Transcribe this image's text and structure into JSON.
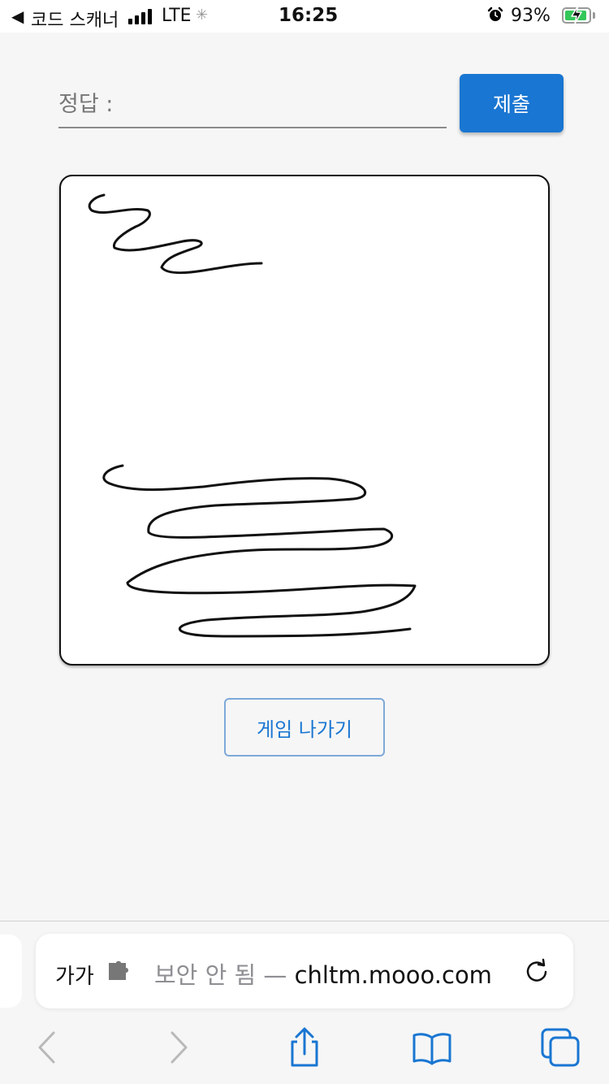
{
  "status_bar": {
    "back_glyph": "◀",
    "back_app": "코드 스캐너",
    "network": "LTE",
    "time": "16:25",
    "battery_percent": "93%",
    "battery_level": 0.93,
    "icons": [
      "signal-icon",
      "loading-icon",
      "alarm-icon",
      "battery-charging-icon"
    ]
  },
  "answer": {
    "placeholder": "정답 :",
    "value": "",
    "submit_label": "제출"
  },
  "exit_label": "게임 나가기",
  "browser": {
    "text_size_label": "가가",
    "security_label": "보안 안 됨 — ",
    "domain": "chltm.mooo.com",
    "icons": [
      "puzzle-icon",
      "reload-icon",
      "back-icon",
      "forward-icon",
      "share-icon",
      "bookmarks-icon",
      "tabs-icon"
    ]
  },
  "colors": {
    "primary": "#1976d2",
    "background": "#f6f6f6",
    "stroke": "#111111"
  }
}
